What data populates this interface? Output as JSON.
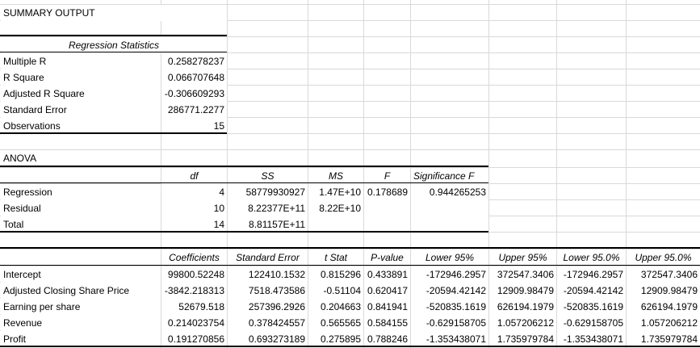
{
  "title": "SUMMARY OUTPUT",
  "regression_statistics": {
    "header": "Regression Statistics",
    "rows": [
      {
        "label": "Multiple R",
        "value": "0.258278237"
      },
      {
        "label": "R Square",
        "value": "0.066707648"
      },
      {
        "label": "Adjusted R Square",
        "value": "-0.306609293"
      },
      {
        "label": "Standard Error",
        "value": "286771.2277"
      },
      {
        "label": "Observations",
        "value": "15"
      }
    ]
  },
  "anova": {
    "title": "ANOVA",
    "headers": [
      "df",
      "SS",
      "MS",
      "F",
      "Significance F"
    ],
    "rows": [
      {
        "label": "Regression",
        "df": "4",
        "ss": "58779930927",
        "ms": "1.47E+10",
        "f": "0.178689",
        "sig_f": "0.944265253"
      },
      {
        "label": "Residual",
        "df": "10",
        "ss": "8.22377E+11",
        "ms": "8.22E+10",
        "f": "",
        "sig_f": ""
      },
      {
        "label": "Total",
        "df": "14",
        "ss": "8.81157E+11",
        "ms": "",
        "f": "",
        "sig_f": ""
      }
    ]
  },
  "coefficients": {
    "headers": [
      "Coefficients",
      "Standard Error",
      "t Stat",
      "P-value",
      "Lower 95%",
      "Upper 95%",
      "Lower 95.0%",
      "Upper 95.0%"
    ],
    "rows": [
      {
        "label": "Intercept",
        "values": [
          "99800.52248",
          "122410.1532",
          "0.815296",
          "0.433891",
          "-172946.2957",
          "372547.3406",
          "-172946.2957",
          "372547.3406"
        ]
      },
      {
        "label": "Adjusted Closing Share Price",
        "values": [
          "-3842.218313",
          "7518.473586",
          "-0.51104",
          "0.620417",
          "-20594.42142",
          "12909.98479",
          "-20594.42142",
          "12909.98479"
        ]
      },
      {
        "label": "Earning per share",
        "values": [
          "52679.518",
          "257396.2926",
          "0.204663",
          "0.841941",
          "-520835.1619",
          "626194.1979",
          "-520835.1619",
          "626194.1979"
        ]
      },
      {
        "label": "Revenue",
        "values": [
          "0.214023754",
          "0.378424557",
          "0.565565",
          "0.584155",
          "-0.629158705",
          "1.057206212",
          "-0.629158705",
          "1.057206212"
        ]
      },
      {
        "label": "Profit",
        "values": [
          "0.191270856",
          "0.693273189",
          "0.275895",
          "0.788246",
          "-1.353438071",
          "1.735979784",
          "-1.353438071",
          "1.735979784"
        ]
      }
    ]
  }
}
